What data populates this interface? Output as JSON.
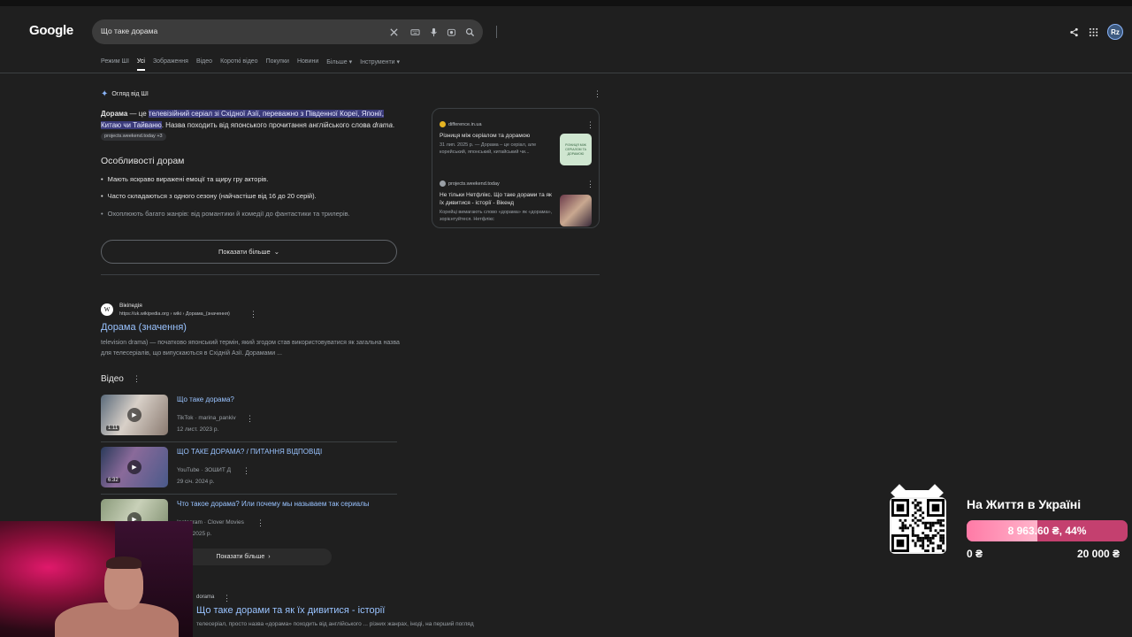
{
  "header": {
    "logo": "Google",
    "search_value": "Що таке дорама",
    "avatar_initials": "Rz"
  },
  "tabs": [
    "Режим ШІ",
    "Усі",
    "Зображення",
    "Відео",
    "Короткі відео",
    "Покупки",
    "Новини",
    "Більше ▾",
    "Інструменти ▾"
  ],
  "active_tab": "Усі",
  "ai_overview": {
    "heading": "Огляд від ШІ",
    "term": "Дорама",
    "intro_plain": " — це ",
    "intro_highlight": "телевізійний серіал зі Східної Азії, переважно з Південної Кореї, Японії, Китаю чи Тайваню",
    "intro_rest": ". Назва походить від японського прочитання англійського слова ",
    "intro_word": "drama",
    "intro_end": ".",
    "chip": "projects.weekend.today +3",
    "features_title": "Особливості дорам",
    "bullets": [
      "Мають яскраво виражені емоції та щиру гру акторів.",
      "Часто складаються з одного сезону (найчастіше від 16 до 20 серій).",
      "Охоплюють багато жанрів: від романтики й комедії до фантастики та трилерів."
    ],
    "show_more": "Показати більше",
    "sources": [
      {
        "site": "difference.in.ua",
        "title": "Різниця між серіалом та дорамою",
        "snippet": "31 лип. 2025 р. — Дорама – це серіал, але корейський, японський, китайський чи...",
        "thumb_text": "РІЗНИЦЯ МІЖ СЕРІАЛОМ ТА ДОРАМОЮ"
      },
      {
        "site": "projects.weekend.today",
        "title": "Не тільки Нетфлікс. Що таке дорами та як їх дивитися - історії - Вікенд",
        "snippet": "Корейці вимагають слово «дорама» як «дорама», зорієнтуйтеся. Нетфлікс"
      }
    ]
  },
  "wiki": {
    "favicon": "W",
    "name": "Вікіпедія",
    "url": "https://uk.wikipedia.org › wiki › Дорама_(значення)",
    "title": "Дорама (значення)",
    "snippet": "television drama) — початково японський термін, який згодом став використовуватися як загальна назва для телесеріалів, що випускаються в Східній Азії. Дорамами ..."
  },
  "videos": {
    "heading": "Відео",
    "items": [
      {
        "title": "Що таке дорама?",
        "source": "TikTok · marina_pankiv",
        "date": "12 лист. 2023 р.",
        "duration": "1:11"
      },
      {
        "title": "ЩО ТАКЕ ДОРАМА? / ПИТАННЯ ВІДПОВІДІ",
        "source": "YouTube · ЗОШИТ Д",
        "date": "29 січ. 2024 р.",
        "duration": "6:32"
      },
      {
        "title": "Что такое дорама? Или почему мы называем так сериалы",
        "source": "Instagram · Clover Movies",
        "date": "серп. 2025 р.",
        "duration": ""
      }
    ],
    "show_more": "Показати більше"
  },
  "result3": {
    "site": "dorama",
    "title": "Що таке дорами та як їх дивитися - історії",
    "snippet": "телесеріал, просто назва «дорама» походить від англійського ... різних жанрах, іноді, на перший погляд"
  },
  "donation": {
    "title": "На Життя в Україні",
    "progress_text": "8 963.60 ₴, 44%",
    "progress_fraction": 0.44,
    "min": "0 ₴",
    "max": "20 000 ₴"
  },
  "colors": {
    "background": "#1f1f1f",
    "link": "#99c3ff",
    "highlight": "#3a3a7a",
    "donation_bar": "#c4406f"
  }
}
